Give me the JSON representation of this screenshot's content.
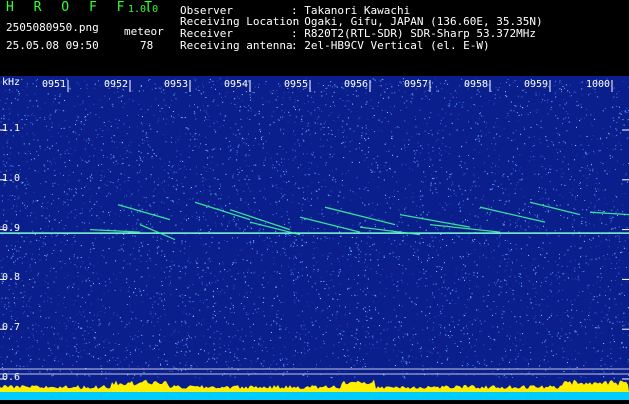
{
  "header": {
    "app_title": "H R O F F T",
    "version": "1.0.0",
    "file_name": "2505080950.png",
    "date_time": "25.05.08 09:50",
    "meteor_label": "meteor",
    "meteor_count": "78"
  },
  "info": [
    {
      "label": "Observer",
      "value": ": Takanori Kawachi"
    },
    {
      "label": "Receiving Location",
      "value": ": Ogaki, Gifu, JAPAN (136.60E, 35.35N)"
    },
    {
      "label": "Receiver",
      "value": ": R820T2(RTL-SDR) SDR-Sharp 53.372MHz"
    },
    {
      "label": "Receiving antenna",
      "value": ": 2el-HB9CV Vertical (el. E-W)"
    }
  ],
  "spectrogram": {
    "y_unit": "kHz",
    "y_ticks": [
      "1.1",
      "1.0",
      "0.9",
      "0.8",
      "0.7",
      "0.6"
    ],
    "x_ticks": [
      "0951",
      "0952",
      "0953",
      "0954",
      "0955",
      "0956",
      "0957",
      "0958",
      "0959",
      "1000"
    ],
    "colors": {
      "background": "#0b1f8c",
      "noise": "#3f7fff",
      "carrier": "#7fffd4",
      "trace": "#40ffa0",
      "level": "#ffee00",
      "floor": "#00ccff"
    }
  }
}
